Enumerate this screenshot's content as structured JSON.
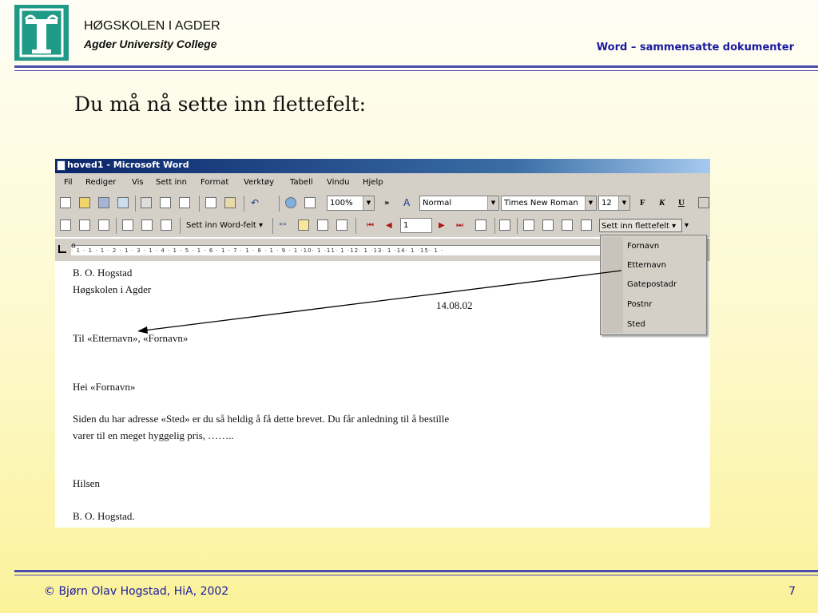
{
  "header": {
    "school": "HØGSKOLEN I AGDER",
    "college": "Agder University College",
    "topic": "Word – sammensatte dokumenter"
  },
  "slide": {
    "heading": "Du må nå sette inn flettefelt:"
  },
  "window": {
    "title": "hoved1 - Microsoft Word"
  },
  "menu": [
    "Fil",
    "Rediger",
    "Vis",
    "Sett inn",
    "Format",
    "Verktøy",
    "Tabell",
    "Vindu",
    "Hjelp"
  ],
  "toolbar": {
    "zoom": "100%",
    "style": "Normal",
    "font": "Times New Roman",
    "size": "12",
    "bold": "F",
    "italic": "K",
    "underline": "U",
    "insert_word_field": "Sett inn Word-felt",
    "record": "1",
    "insert_merge_field": "Sett inn flettefelt"
  },
  "ruler": {
    "marks": "· 1 · 1 · 1 · 2 · 1 · 3 · 1 · 4 · 1 · 5 · 1 · 6 · 1 · 7 · 1 · 8 · 1 · 9 · 1 ·10· 1 ·11· 1 ·12· 1 ·13· 1 ·14· 1 ·15· 1 ·"
  },
  "dropdown": {
    "options": [
      "Fornavn",
      "Etternavn",
      "Gatepostadr",
      "Postnr",
      "Sted"
    ]
  },
  "document": {
    "sender_name": "B. O. Hogstad",
    "sender_org": "Høgskolen i Agder",
    "date": "14.08.02",
    "recipient": "Til «Etternavn», «Fornavn»",
    "greeting": "Hei «Fornavn»",
    "body1": "Siden du har adresse «Sted»   er du så heldig å få dette brevet. Du får anledning til å bestille",
    "body2": "varer til en meget hyggelig pris, ……..",
    "closing": "Hilsen",
    "signature": "B. O. Hogstad."
  },
  "footer": {
    "copyright": "© Bjørn Olav Hogstad, HiA, 2002",
    "page": "7"
  },
  "colors": {
    "accent": "#1a1aa0",
    "logo": "#1f9a86",
    "rule": "#4b4bb0"
  }
}
